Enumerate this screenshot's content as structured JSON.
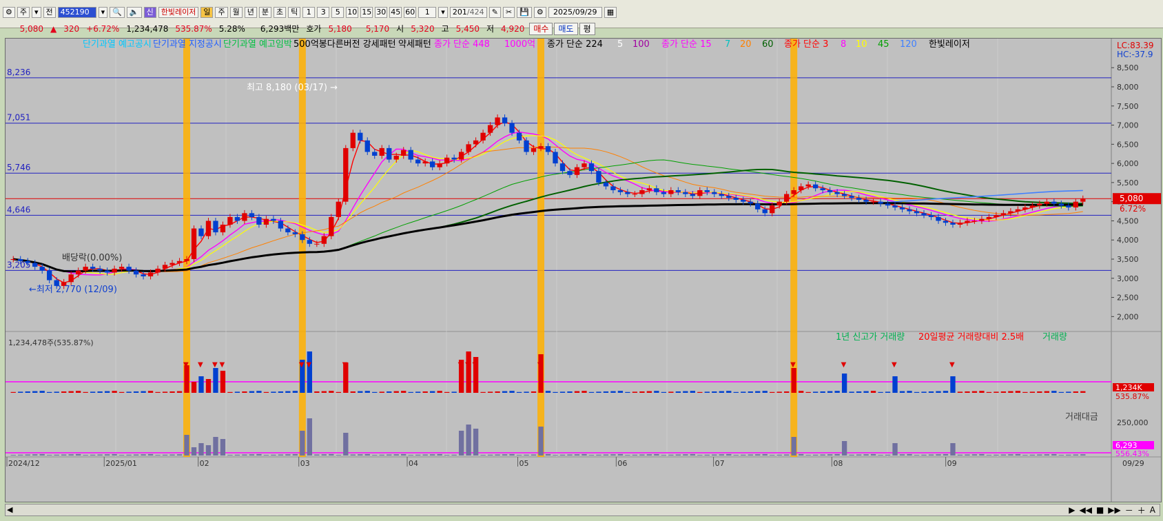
{
  "toolbar": {
    "market": "주",
    "prev_label": "전",
    "code": "452190",
    "sin": "신",
    "radar": "한빛레이저",
    "periods": [
      "일",
      "주",
      "월",
      "년",
      "분",
      "초",
      "틱"
    ],
    "active_period": "일",
    "minute_options": [
      "1",
      "3",
      "5",
      "10",
      "15",
      "30",
      "45",
      "60"
    ],
    "multiplier": "1",
    "count": "201",
    "count_total": "/424",
    "date": "2025/09/29"
  },
  "quote": {
    "price": "5,080",
    "change": "320",
    "change_pct": "+6.72%",
    "volume": "1,234,478",
    "vol_ratio": "535.87%",
    "turnover_pct": "5.28%",
    "amount": "6,293백만",
    "bid_label": "호가",
    "ask": "5,180",
    "bid": "5,170",
    "open_label": "시",
    "open": "5,320",
    "high_label": "고",
    "high": "5,450",
    "low_label": "저",
    "low": "4,920",
    "buy": "매수",
    "sell": "매도",
    "eval": "평"
  },
  "legend": {
    "items": [
      {
        "text": "단기과열 예고공시",
        "color": "#00c8ff"
      },
      {
        "text": "단기과열 지정공시",
        "color": "#2060ff"
      },
      {
        "text": "단기과열 예고임박",
        "color": "#00c040"
      },
      {
        "text": "500억봉다른버전 강세패턴",
        "color": "#000000"
      },
      {
        "text": "약세패턴",
        "color": "#000000"
      },
      {
        "text": "종가 단순 448",
        "color": "#ff00ff"
      },
      {
        "text": "1000억",
        "color": "#ff00ff"
      },
      {
        "text": "종가 단순 224",
        "color": "#000000"
      },
      {
        "text": "5",
        "color": "#ffffff"
      },
      {
        "text": "100",
        "color": "#a000a0"
      },
      {
        "text": "종가 단순 15",
        "color": "#ff00ff"
      },
      {
        "text": "7",
        "color": "#00c0c0"
      },
      {
        "text": "20",
        "color": "#ff8000"
      },
      {
        "text": "60",
        "color": "#006000"
      },
      {
        "text": "종가 단순 3",
        "color": "#ff0000"
      },
      {
        "text": "8",
        "color": "#ff00ff"
      },
      {
        "text": "10",
        "color": "#ffff00"
      },
      {
        "text": "45",
        "color": "#00a000"
      },
      {
        "text": "120",
        "color": "#4080ff"
      },
      {
        "text": "한빛레이저",
        "color": "#000000"
      }
    ],
    "lc": "LC:83.39",
    "hc": "HC:-37.9"
  },
  "annotations": {
    "high": "최고 8,180 (03/17) →",
    "low": "←최저 2,770 (12/09)",
    "dividend": "배당락(0.00%)",
    "volume_info": "1,234,478주(535.87%)",
    "vol_legend": [
      {
        "text": "1년 신고가 거래량",
        "color": "#00b050"
      },
      {
        "text": "20일평균 거래량대비 2.5배",
        "color": "#ff0000"
      },
      {
        "text": "거래량",
        "color": "#00b050"
      }
    ],
    "amount_legend": "거래대금",
    "vol_badge": "1,234K",
    "vol_badge_pct": "535.87%",
    "amt_badge": "6,293",
    "amt_badge_pct": "556.43%",
    "price_badge": "5,080",
    "price_badge_pct": "6.72%"
  },
  "chart_data": {
    "type": "candlestick",
    "y_axis": {
      "min": 1700,
      "max": 8900,
      "ticks": [
        2000,
        2500,
        3000,
        3500,
        4000,
        4500,
        5000,
        5500,
        6000,
        6500,
        7000,
        7500,
        8000,
        8500
      ]
    },
    "h_lines": [
      {
        "label": "8,236",
        "value": 8236,
        "color": "#2020c0"
      },
      {
        "label": "7,051",
        "value": 7051,
        "color": "#2020c0"
      },
      {
        "label": "5,746",
        "value": 5746,
        "color": "#2020c0"
      },
      {
        "label": "4,646",
        "value": 4646,
        "color": "#2020c0"
      },
      {
        "label": "3,205",
        "value": 3205,
        "color": "#2020c0"
      },
      {
        "label": "",
        "value": 5080,
        "color": "#e00000"
      }
    ],
    "x_labels": [
      {
        "text": "2024/12",
        "pos": 0.0
      },
      {
        "text": "2025/01",
        "pos": 0.088
      },
      {
        "text": "02",
        "pos": 0.173
      },
      {
        "text": "03",
        "pos": 0.264
      },
      {
        "text": "04",
        "pos": 0.362
      },
      {
        "text": "05",
        "pos": 0.462
      },
      {
        "text": "06",
        "pos": 0.551
      },
      {
        "text": "07",
        "pos": 0.639
      },
      {
        "text": "08",
        "pos": 0.746
      },
      {
        "text": "09",
        "pos": 0.849
      }
    ],
    "end_label": "09/29",
    "closes": [
      3500,
      3450,
      3400,
      3300,
      3200,
      2950,
      2800,
      2900,
      3100,
      3200,
      3300,
      3250,
      3200,
      3150,
      3250,
      3300,
      3200,
      3100,
      3050,
      3150,
      3250,
      3350,
      3400,
      3450,
      3500,
      4300,
      4100,
      4500,
      4200,
      4400,
      4600,
      4500,
      4700,
      4600,
      4400,
      4550,
      4500,
      4300,
      4200,
      4150,
      4000,
      3900,
      3900,
      4100,
      4600,
      5000,
      6400,
      6800,
      6600,
      6300,
      6200,
      6400,
      6100,
      6200,
      6350,
      6100,
      6000,
      6050,
      5900,
      6000,
      6150,
      6100,
      6300,
      6500,
      6600,
      6800,
      7000,
      7200,
      7050,
      6800,
      6600,
      6300,
      6400,
      6450,
      6300,
      6000,
      5800,
      5700,
      5900,
      6000,
      5800,
      5500,
      5400,
      5300,
      5250,
      5200,
      5200,
      5300,
      5350,
      5250,
      5200,
      5300,
      5250,
      5200,
      5150,
      5300,
      5250,
      5200,
      5150,
      5100,
      5050,
      5000,
      4950,
      4800,
      4700,
      4900,
      5000,
      5200,
      5300,
      5400,
      5450,
      5350,
      5300,
      5250,
      5200,
      5150,
      5100,
      5050,
      5000,
      5000,
      4950,
      4900,
      4850,
      4800,
      4750,
      4700,
      4650,
      4600,
      4500,
      4450,
      4400,
      4450,
      4500,
      4500,
      4550,
      4600,
      4650,
      4700,
      4750,
      4800,
      4850,
      4900,
      4950,
      5000,
      4950,
      4900,
      4850,
      5000,
      5080
    ]
  },
  "controls": {
    "scroll_left": "◀",
    "scroll_right_buttons": [
      "▶",
      "◀◀",
      "■",
      "▶▶",
      "－",
      "＋",
      "A"
    ]
  }
}
